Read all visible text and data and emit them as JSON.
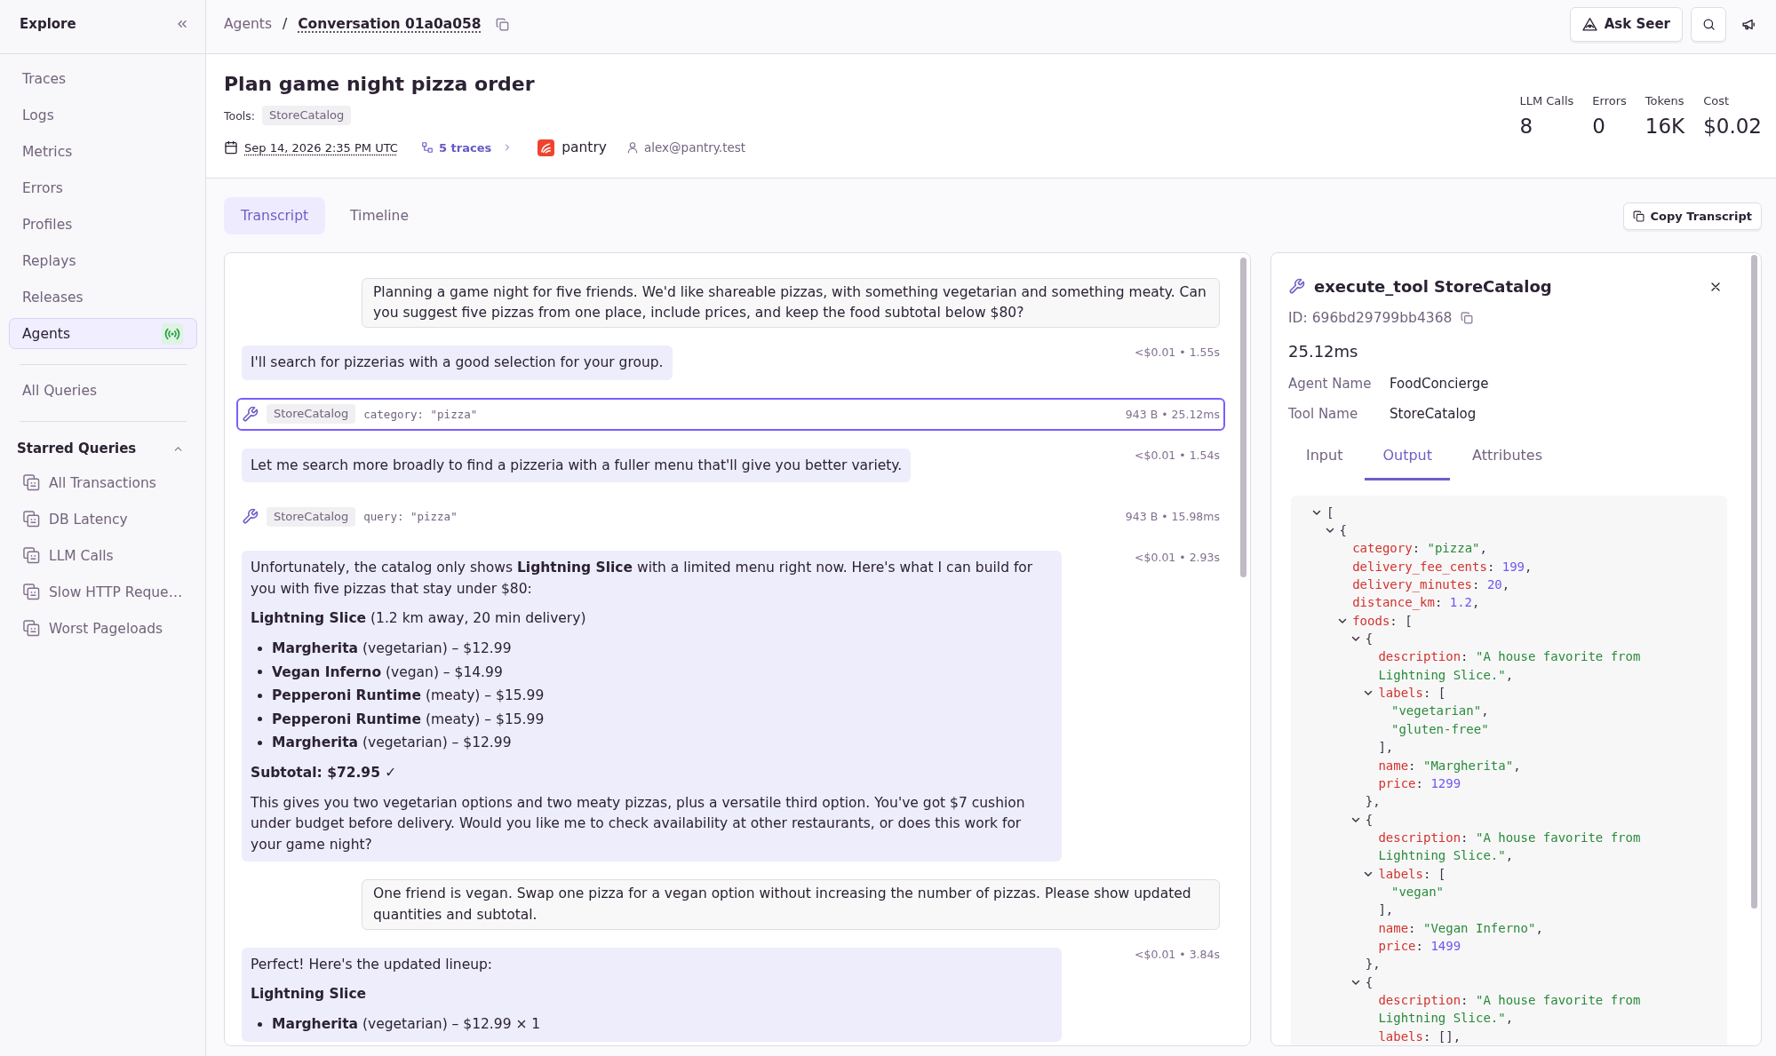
{
  "sidebar": {
    "title": "Explore",
    "items": [
      {
        "label": "Traces",
        "selected": false,
        "kind": "plain"
      },
      {
        "label": "Logs",
        "selected": false,
        "kind": "plain"
      },
      {
        "label": "Metrics",
        "selected": false,
        "kind": "plain"
      },
      {
        "label": "Errors",
        "selected": false,
        "kind": "plain"
      },
      {
        "label": "Profiles",
        "selected": false,
        "kind": "plain"
      },
      {
        "label": "Replays",
        "selected": false,
        "kind": "plain"
      },
      {
        "label": "Releases",
        "selected": false,
        "kind": "plain"
      },
      {
        "label": "Agents",
        "selected": true,
        "kind": "live"
      }
    ],
    "more_items": [
      {
        "label": "All Queries",
        "selected": false
      }
    ],
    "starred": {
      "title": "Starred Queries",
      "expanded": true,
      "items": [
        {
          "label": "All Transactions"
        },
        {
          "label": "DB Latency"
        },
        {
          "label": "LLM Calls"
        },
        {
          "label": "Slow HTTP Reque…"
        },
        {
          "label": "Worst Pageloads"
        }
      ]
    }
  },
  "top_bar": {
    "breadcrumbs": [
      {
        "label": "Agents",
        "current": false
      },
      {
        "label": "Conversation 01a0a058",
        "current": true
      }
    ],
    "separator": "/",
    "ask_button": "Ask Seer"
  },
  "header": {
    "title": "Plan game night pizza order",
    "tools_label": "Tools:",
    "tools": [
      "StoreCatalog"
    ],
    "date": "Sep 14, 2026 2:35 PM UTC",
    "traces": "5 traces",
    "project": "pantry",
    "user": "alex@pantry.test",
    "stats": [
      {
        "label": "LLM Calls",
        "value": "8"
      },
      {
        "label": "Errors",
        "value": "0"
      },
      {
        "label": "Tokens",
        "value": "16K"
      },
      {
        "label": "Cost",
        "value": "$0.02"
      }
    ]
  },
  "tabs": [
    {
      "label": "Transcript",
      "selected": true
    },
    {
      "label": "Timeline",
      "selected": false
    }
  ],
  "copy_button": "Copy Transcript",
  "transcript": {
    "messages": [
      {
        "kind": "user",
        "text": "Planning a game night for five friends. We'd like shareable pizzas, with something vegetarian and something meaty. Can you suggest five pizzas from one place, include prices, and keep the food subtotal below $80?"
      },
      {
        "kind": "assistant",
        "meta": "<$0.01 • 1.55s",
        "blocks": [
          {
            "kind": "paragraph",
            "text": "I'll search for pizzerias with a good selection for your group."
          }
        ]
      },
      {
        "kind": "tool",
        "selected": true,
        "tool": "StoreCatalog",
        "args": "category: \"pizza\"",
        "meta": "943 B • 25.12ms"
      },
      {
        "kind": "assistant",
        "meta": "<$0.01 • 1.54s",
        "blocks": [
          {
            "kind": "paragraph",
            "text": "Let me search more broadly to find a pizzeria with a fuller menu that'll give you better variety."
          }
        ]
      },
      {
        "kind": "tool",
        "selected": false,
        "tool": "StoreCatalog",
        "args": "query: \"pizza\"",
        "meta": "943 B • 15.98ms"
      },
      {
        "kind": "assistant",
        "meta": "<$0.01 • 2.93s",
        "blocks": [
          {
            "kind": "paragraph",
            "text": "Unfortunately, the catalog only shows **Lightning Slice** with a limited menu right now. Here's what I can build for you with five pizzas that stay under $80:"
          },
          {
            "kind": "paragraph",
            "text": "**Lightning Slice** (1.2 km away, 20 min delivery)"
          },
          {
            "kind": "list",
            "items": [
              "**Margherita** (vegetarian) – $12.99",
              "**Vegan Inferno** (vegan) – $14.99",
              "**Pepperoni Runtime** (meaty) – $15.99",
              "**Pepperoni Runtime** (meaty) – $15.99",
              "**Margherita** (vegetarian) – $12.99"
            ]
          },
          {
            "kind": "strong",
            "text": "Subtotal: $72.95 ✓"
          },
          {
            "kind": "paragraph",
            "text": "This gives you two vegetarian options and two meaty pizzas, plus a versatile third option. You've got $7 cushion under budget before delivery. Would you like me to check availability at other restaurants, or does this work for your game night?"
          }
        ]
      },
      {
        "kind": "user",
        "text": "One friend is vegan. Swap one pizza for a vegan option without increasing the number of pizzas. Please show updated quantities and subtotal."
      },
      {
        "kind": "assistant",
        "meta": "<$0.01 • 3.84s",
        "blocks": [
          {
            "kind": "paragraph",
            "text": "Perfect! Here's the updated lineup:"
          },
          {
            "kind": "strong",
            "text": "Lightning Slice"
          },
          {
            "kind": "list",
            "items": [
              "**Margherita** (vegetarian) – $12.99 × 1"
            ]
          }
        ]
      }
    ]
  },
  "detail": {
    "title": "execute_tool StoreCatalog",
    "id": "ID: 696bd29799bb4368",
    "duration": "25.12ms",
    "fields": [
      {
        "label": "Agent Name",
        "value": "FoodConcierge"
      },
      {
        "label": "Tool Name",
        "value": "StoreCatalog"
      }
    ],
    "tabs": [
      {
        "label": "Input",
        "selected": false
      },
      {
        "label": "Output",
        "selected": true
      },
      {
        "label": "Attributes",
        "selected": false
      }
    ],
    "output": [
      {
        "kind": "array",
        "open": "[",
        "expanded": true,
        "children": [
          {
            "kind": "object",
            "open": "{",
            "expanded": true,
            "children": [
              {
                "kind": "string",
                "key": "category",
                "sep": ": ",
                "value": "\"pizza\"",
                "end": ","
              },
              {
                "kind": "number",
                "key": "delivery_fee_cents",
                "sep": ": ",
                "value": "199",
                "end": ","
              },
              {
                "kind": "number",
                "key": "delivery_minutes",
                "sep": ": ",
                "value": "20",
                "end": ","
              },
              {
                "kind": "number",
                "key": "distance_km",
                "sep": ": ",
                "value": "1.2",
                "end": ","
              },
              {
                "kind": "array",
                "key": "foods",
                "sep": ": ",
                "open": "[",
                "expanded": true,
                "children": [
                  {
                    "kind": "object",
                    "open": "{",
                    "expanded": true,
                    "children": [
                      {
                        "kind": "string",
                        "key": "description",
                        "sep": ": ",
                        "value": "\"A house favorite from Lightning Slice.\"",
                        "end": ","
                      },
                      {
                        "kind": "array",
                        "key": "labels",
                        "sep": ": ",
                        "open": "[",
                        "expanded": true,
                        "children": [
                          {
                            "kind": "string",
                            "value": "\"vegetarian\"",
                            "end": ","
                          },
                          {
                            "kind": "string",
                            "value": "\"gluten-free\""
                          }
                        ],
                        "close": "],"
                      },
                      {
                        "kind": "string",
                        "key": "name",
                        "sep": ": ",
                        "value": "\"Margherita\"",
                        "end": ","
                      },
                      {
                        "kind": "number",
                        "key": "price",
                        "sep": ": ",
                        "value": "1299"
                      }
                    ],
                    "close": "},"
                  },
                  {
                    "kind": "object",
                    "open": "{",
                    "expanded": true,
                    "children": [
                      {
                        "kind": "string",
                        "key": "description",
                        "sep": ": ",
                        "value": "\"A house favorite from Lightning Slice.\"",
                        "end": ","
                      },
                      {
                        "kind": "array",
                        "key": "labels",
                        "sep": ": ",
                        "open": "[",
                        "expanded": true,
                        "children": [
                          {
                            "kind": "string",
                            "value": "\"vegan\""
                          }
                        ],
                        "close": "],"
                      },
                      {
                        "kind": "string",
                        "key": "name",
                        "sep": ": ",
                        "value": "\"Vegan Inferno\"",
                        "end": ","
                      },
                      {
                        "kind": "number",
                        "key": "price",
                        "sep": ": ",
                        "value": "1499"
                      }
                    ],
                    "close": "},"
                  },
                  {
                    "kind": "object",
                    "open": "{",
                    "expanded": true,
                    "children": [
                      {
                        "kind": "string",
                        "key": "description",
                        "sep": ": ",
                        "value": "\"A house favorite from Lightning Slice.\"",
                        "end": ","
                      },
                      {
                        "kind": "empty",
                        "key": "labels",
                        "sep": ": ",
                        "value": "[]",
                        "end": ","
                      }
                    ]
                  }
                ]
              }
            ]
          }
        ]
      }
    ]
  }
}
